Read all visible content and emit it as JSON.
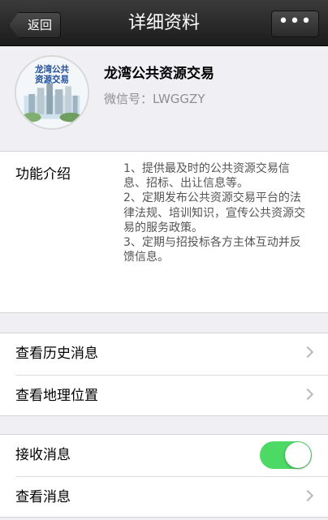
{
  "navbar": {
    "back_label": "返回",
    "title": "详细资料",
    "more_label": "•••"
  },
  "profile": {
    "name": "龙湾公共资源交易",
    "wechat_id": "微信号：LWGGZY",
    "avatar_text_line1": "龙湾公共",
    "avatar_text_line2": "资源交易"
  },
  "intro": {
    "label": "功能介绍",
    "text": "1、提供最及时的公共资源交易信息、招标、出让信息等。\n2、定期发布公共资源交易平台的法律法规、培训知识，宣传公共资源交易的服务政策。\n3、定期与招投标各方主体互动并反馈信息。"
  },
  "group1": {
    "history_label": "查看历史消息",
    "location_label": "查看地理位置"
  },
  "group2": {
    "receive_label": "接收消息",
    "receive_enabled": true,
    "view_label": "查看消息"
  },
  "colors": {
    "toggle_on": "#4cd964",
    "navbar": "#2a2a2a"
  }
}
